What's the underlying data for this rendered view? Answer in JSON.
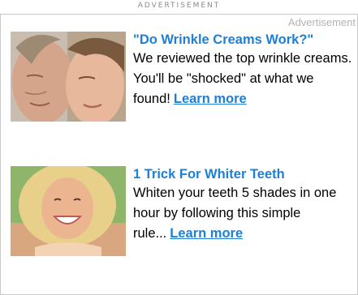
{
  "header": {
    "label": "ADVERTISEMENT"
  },
  "frame": {
    "label": "Advertisement"
  },
  "ads": [
    {
      "image": "aging-skin-comparison-photo",
      "headline": "\"Do Wrinkle Creams Work?\"",
      "body": "We reviewed the top wrinkle creams. You'll be \"shocked\" at what we found!",
      "link": "Learn more"
    },
    {
      "image": "smiling-woman-photo",
      "headline": "1 Trick For Whiter Teeth",
      "body": "Whiten your teeth 5 shades in one hour by following this simple rule...",
      "link": "Learn more"
    }
  ],
  "colors": {
    "link": "#1d7fd6",
    "border": "#c8c8c8",
    "muted": "#b4b4b4"
  }
}
